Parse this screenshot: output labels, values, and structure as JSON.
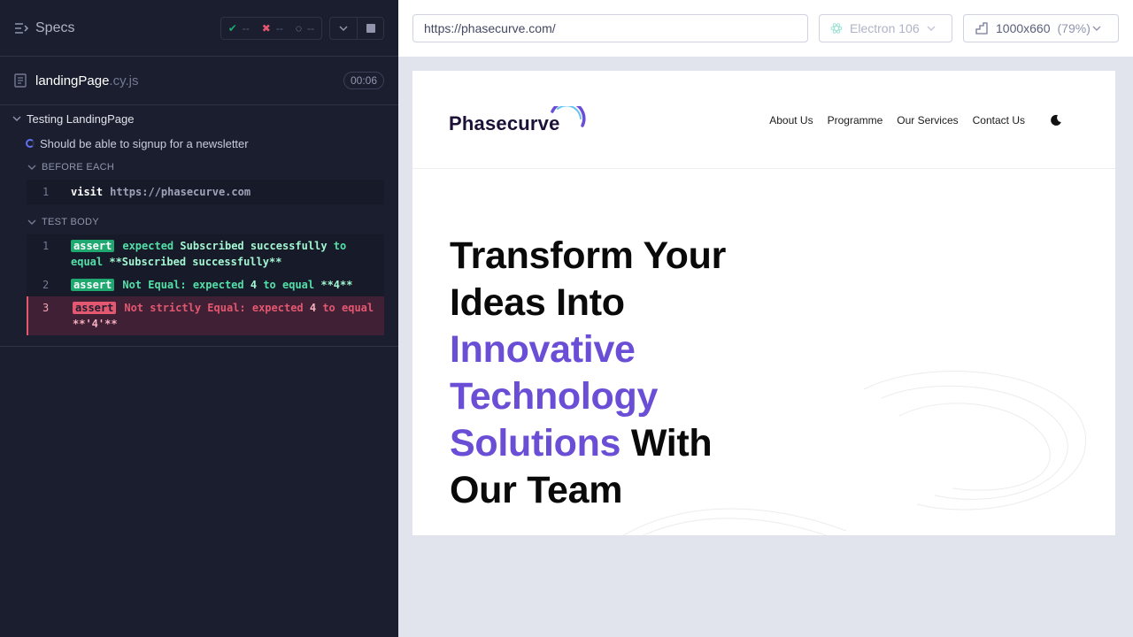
{
  "reporter": {
    "specs_label": "Specs",
    "stats": {
      "passed": "--",
      "failed": "--",
      "pending": "--"
    },
    "spec_file": {
      "name": "landingPage",
      "ext": ".cy.js",
      "duration": "00:06"
    },
    "suite_title": "Testing LandingPage",
    "test_title": "Should be able to signup for a newsletter",
    "before_each": {
      "label": "BEFORE EACH",
      "commands": [
        {
          "num": "1",
          "name": "visit",
          "message": "https://phasecurve.com"
        }
      ]
    },
    "test_body": {
      "label": "TEST BODY",
      "commands": [
        {
          "num": "1",
          "badge": "assert",
          "pre": "expected ",
          "strong": "Subscribed successfully",
          "mid": " to equal ",
          "tail": "**Subscribed successfully**",
          "state": "passed"
        },
        {
          "num": "2",
          "badge": "assert",
          "pre": "Not Equal: expected ",
          "strong": "4",
          "mid": " to equal ",
          "tail": "**4**",
          "state": "passed"
        },
        {
          "num": "3",
          "badge": "assert",
          "pre": "Not strictly Equal: expected ",
          "strong": "4",
          "mid": " to equal ",
          "tail": "**'4'**",
          "state": "failed"
        }
      ]
    }
  },
  "aut_header": {
    "url": "https://phasecurve.com/",
    "browser": "Electron 106",
    "viewport": "1000x660",
    "scale": "(79%)"
  },
  "site": {
    "logo": "Phasecurve",
    "nav": [
      "About Us",
      "Programme",
      "Our Services",
      "Contact Us"
    ],
    "hero": {
      "line1": "Transform Your",
      "line2": "Ideas Into",
      "accent1": "Innovative",
      "accent2": "Technology",
      "accent3": "Solutions",
      "after_accent": " With",
      "line_last": "Our Team"
    },
    "accent_color": "#6b4ed6"
  },
  "colors": {
    "pass": "#1fa971",
    "fail": "#e45770",
    "reporter_bg": "#1b1e2e"
  }
}
